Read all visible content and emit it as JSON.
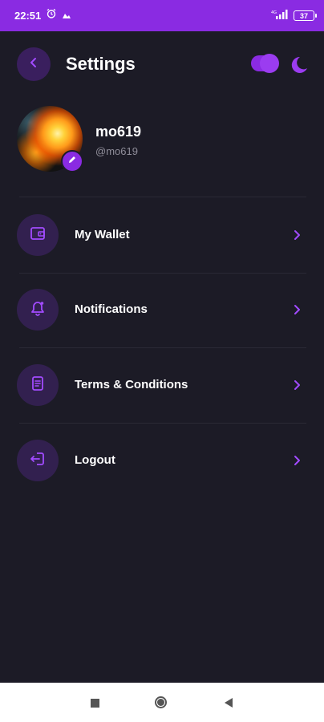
{
  "status_bar": {
    "time": "22:51",
    "battery": "37",
    "alarm_icon": "alarm-clock-icon",
    "notif_icon": "app-notification-icon",
    "signal_icon": "signal-icon",
    "bg_color": "#8a2be2"
  },
  "header": {
    "title": "Settings",
    "back_icon": "chevron-left-icon",
    "theme_toggle": "on",
    "theme_icon": "moon-icon"
  },
  "profile": {
    "name": "mo619",
    "handle": "@mo619",
    "edit_icon": "pencil-icon"
  },
  "menu": [
    {
      "label": "My Wallet",
      "icon": "wallet-icon"
    },
    {
      "label": "Notifications",
      "icon": "bell-icon"
    },
    {
      "label": "Terms & Conditions",
      "icon": "document-icon"
    },
    {
      "label": "Logout",
      "icon": "logout-icon"
    }
  ],
  "colors": {
    "accent": "#8a2be2",
    "background": "#1c1b26",
    "icon_bg": "#32204f"
  },
  "nav_bar": {
    "buttons": [
      "recents",
      "home",
      "back"
    ]
  }
}
